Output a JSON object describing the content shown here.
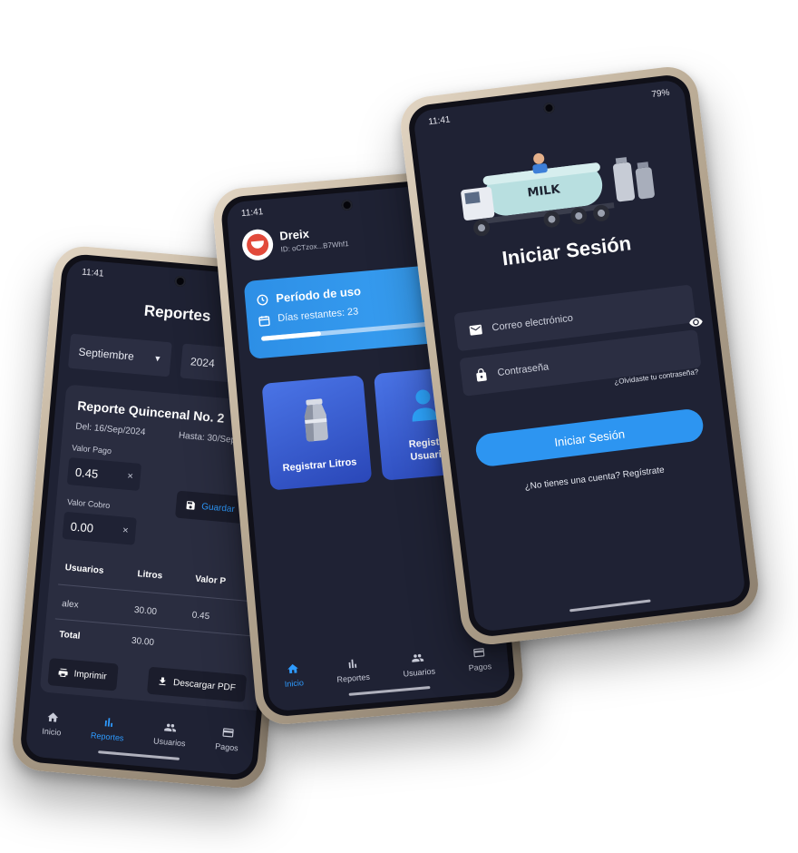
{
  "status_time": "11:41",
  "status_right": "79%",
  "nav": [
    "Inicio",
    "Reportes",
    "Usuarios",
    "Pagos"
  ],
  "reportes": {
    "title": "Reportes",
    "month": "Septiembre",
    "year": "2024",
    "report_title": "Reporte Quincenal No. 2",
    "del": "Del: 16/Sep/2024",
    "hasta": "Hasta: 30/Sep/",
    "valor_pago_label": "Valor Pago",
    "valor_pago": "0.45",
    "valor_cobro_label": "Valor Cobro",
    "valor_cobro": "0.00",
    "guardar": "Guardar",
    "clear_symbol": "×",
    "table_headers": [
      "Usuarios",
      "Litros",
      "Valor P"
    ],
    "rows": [
      [
        "alex",
        "30.00",
        "0.45"
      ]
    ],
    "total_label": "Total",
    "total_litros": "30.00",
    "imprimir": "Imprimir",
    "descargar": "Descargar PDF"
  },
  "inicio": {
    "user_name": "Dreix",
    "user_id": "ID: oCTzox...B7Whf1",
    "periodo_title": "Período de uso",
    "dias": "Días restantes: 23",
    "progress_fraction": 0.28,
    "tile_litros": "Registrar Litros",
    "tile_usuarios_1": "Registrar",
    "tile_usuarios_2": "Usuarios"
  },
  "login": {
    "truck_label": "MILK",
    "title": "Iniciar Sesión",
    "email_placeholder": "Correo electrónico",
    "password_placeholder": "Contraseña",
    "forgot": "¿Olvidaste tu contraseña?",
    "button": "Iniciar Sesión",
    "register": "¿No tienes una cuenta? Regístrate"
  },
  "colors": {
    "screen_bg": "#1f2234",
    "accent": "#2e9bff",
    "card": "#2a2d40"
  }
}
